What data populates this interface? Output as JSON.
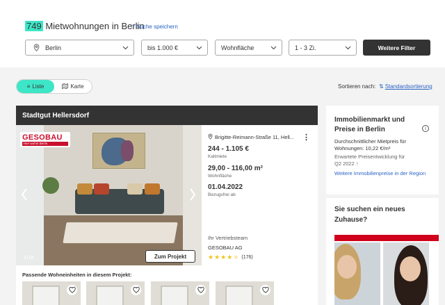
{
  "header": {
    "count": "749",
    "title_rest": " Mietwohnungen in Berlin",
    "save_search": "Suche speichern"
  },
  "filters": {
    "city": "Berlin",
    "price": "bis 1.000 €",
    "area": "Wohnfläche",
    "rooms": "1 - 3 Zi.",
    "more_button": "Weitere Filter"
  },
  "view": {
    "list_label": "Liste",
    "map_label": "Karte",
    "sort_label": "Sortieren nach:",
    "sort_value": "Standardsortierung"
  },
  "listing": {
    "project_title": "Stadtgut Hellersdorf",
    "logo_main": "GESOBAU",
    "logo_sub": "Hier wohnt Berlin.",
    "image_counter": "1/18",
    "project_button": "Zum Projekt",
    "address": "Brigitte-Reimann-Straße 11, Hell...",
    "price": "244 - 1.105 €",
    "price_label": "Kaltmiete",
    "area": "29,00 - 116,00 m²",
    "area_label": "Wohnfläche",
    "available": "01.04.2022",
    "available_label": "Bezugsfrei ab",
    "agent_label": "Ihr Vertriebsteam",
    "agent_company": "GESOBAU AG",
    "rating_count": "(176)",
    "rating_stars": 4.5,
    "matching_units": "Passende Wohneinheiten in diesem Projekt:"
  },
  "sidebar": {
    "title": "Immobilienmarkt und Preise in Berlin",
    "line1": "Durchschnittlicher Mietpreis für",
    "line2": "Wohnungen: 10,22 €/m²",
    "line3": "Erwartete Preisentwicklung für",
    "line4": "Q2 2022 ↑",
    "link": "Weitere Immobilienpreise in der Region",
    "title2": "Sie suchen ein neues Zuhause?"
  },
  "colors": {
    "accent": "#3de6c7",
    "link": "#2b63c4",
    "dark": "#333333",
    "brand_red": "#d0021b"
  }
}
